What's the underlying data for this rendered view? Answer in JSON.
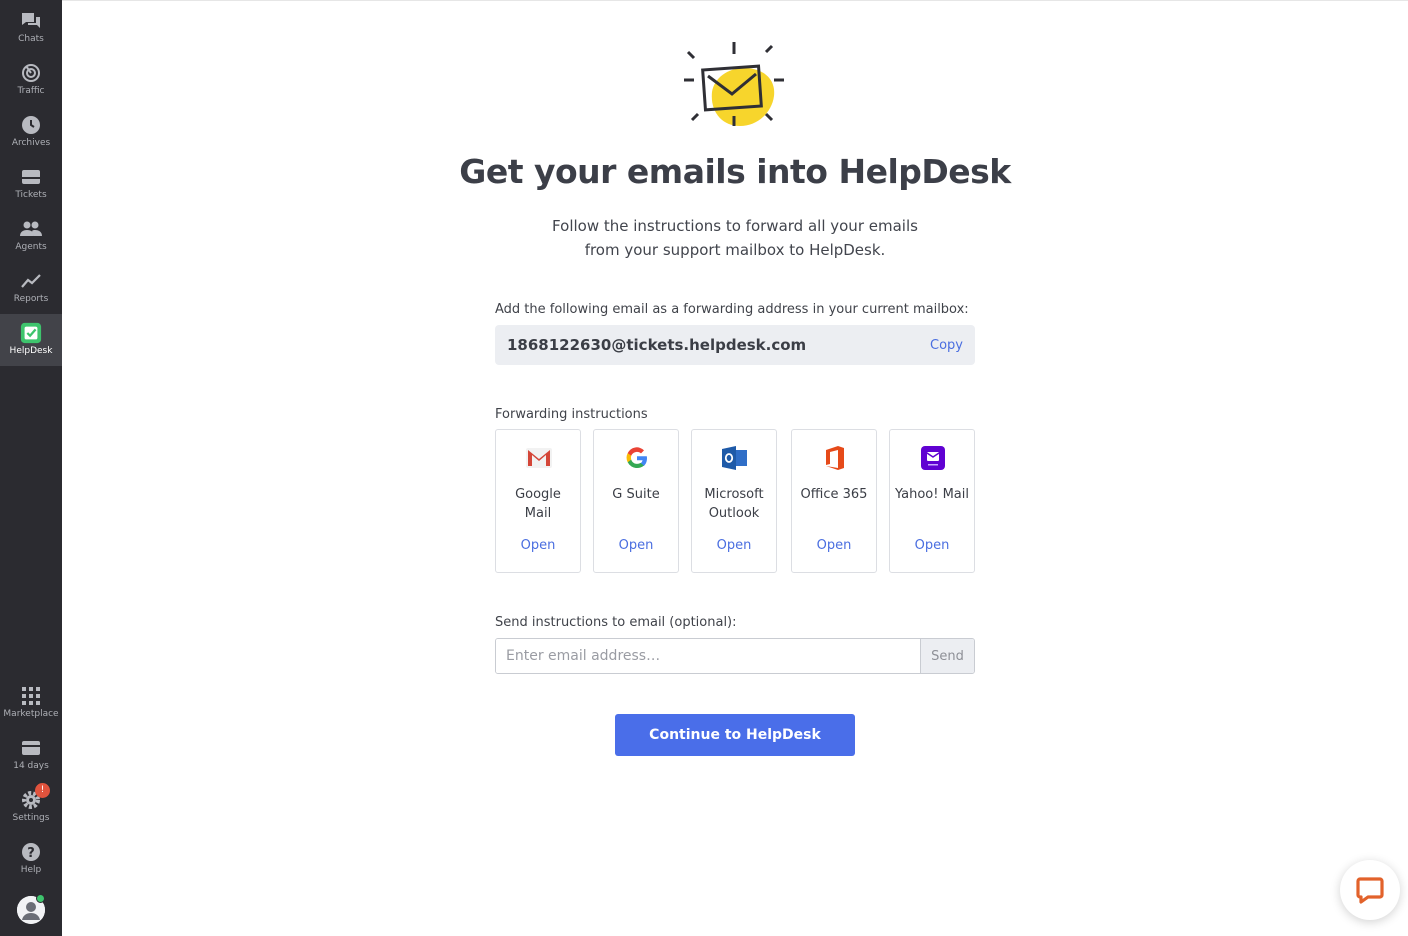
{
  "sidebar": {
    "items": [
      {
        "label": "Chats",
        "icon": "chats-icon"
      },
      {
        "label": "Traffic",
        "icon": "traffic-icon"
      },
      {
        "label": "Archives",
        "icon": "archives-icon"
      },
      {
        "label": "Tickets",
        "icon": "tickets-icon"
      },
      {
        "label": "Agents",
        "icon": "agents-icon"
      },
      {
        "label": "Reports",
        "icon": "reports-icon"
      },
      {
        "label": "HelpDesk",
        "icon": "helpdesk-icon",
        "active": true
      }
    ],
    "bottom": [
      {
        "label": "Marketplace",
        "icon": "marketplace-icon"
      },
      {
        "label": "14 days",
        "icon": "billing-icon"
      },
      {
        "label": "Settings",
        "icon": "settings-icon",
        "badge": "!"
      },
      {
        "label": "Help",
        "icon": "help-icon"
      }
    ]
  },
  "page": {
    "title": "Get your emails into HelpDesk",
    "subtitle": "Follow the instructions to forward all your emails from your support mailbox to HelpDesk.",
    "forward_label": "Add the following email as a forwarding address in your current mailbox:",
    "forward_email": "1868122630@tickets.helpdesk.com",
    "copy_label": "Copy",
    "instructions_label": "Forwarding instructions",
    "providers": [
      {
        "name": "Google Mail",
        "open": "Open",
        "icon": "gmail-icon"
      },
      {
        "name": "G Suite",
        "open": "Open",
        "icon": "google-icon"
      },
      {
        "name": "Microsoft Outlook",
        "open": "Open",
        "icon": "outlook-icon"
      },
      {
        "name": "Office 365",
        "open": "Open",
        "icon": "office365-icon"
      },
      {
        "name": "Yahoo! Mail",
        "open": "Open",
        "icon": "yahoo-mail-icon"
      }
    ],
    "send_label": "Send instructions to email (optional):",
    "send_placeholder": "Enter email address…",
    "send_button": "Send",
    "continue_button": "Continue to HelpDesk"
  },
  "colors": {
    "sidebar_bg": "#2b2b30",
    "accent": "#4a6ee9",
    "link": "#4a6ee0",
    "helpdesk_green": "#3ec46d"
  }
}
